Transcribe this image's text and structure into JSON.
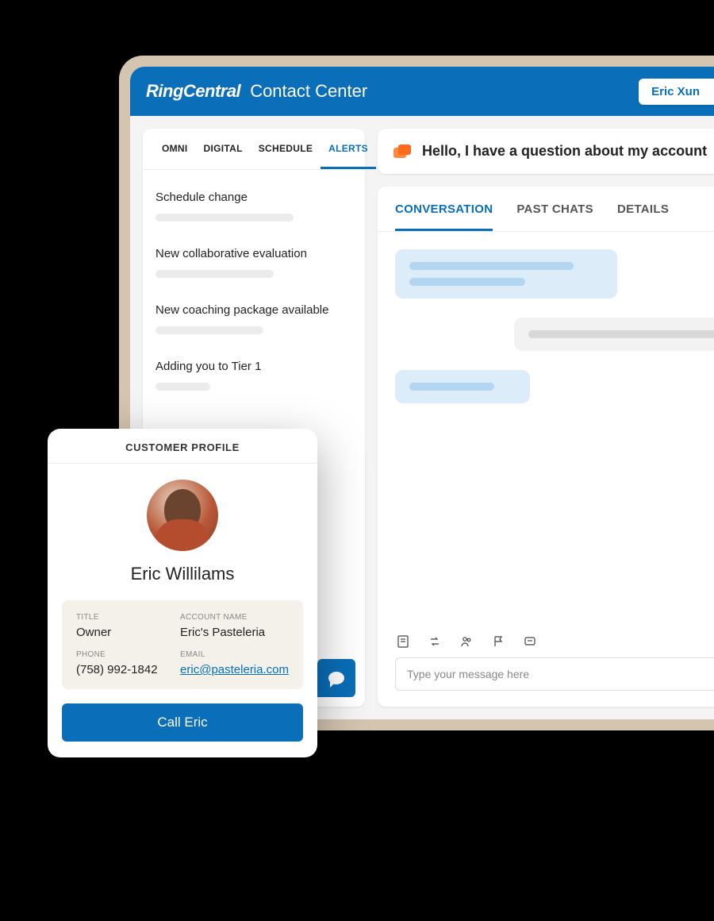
{
  "header": {
    "brand": "RingCentral",
    "product": "Contact Center",
    "user_name": "Eric Xun"
  },
  "sidebar": {
    "tabs": [
      "OMNI",
      "DIGITAL",
      "SCHEDULE",
      "ALERTS"
    ],
    "active_tab_index": 3,
    "alerts": [
      {
        "title": "Schedule change"
      },
      {
        "title": "New collaborative evaluation"
      },
      {
        "title": "New coaching package available"
      },
      {
        "title": "Adding you to Tier 1"
      }
    ]
  },
  "conversation": {
    "prompt": "Hello, I have a question about my account",
    "tabs": [
      "CONVERSATION",
      "PAST CHATS",
      "DETAILS"
    ],
    "active_tab_index": 0,
    "input_placeholder": "Type your message here",
    "toolbar_icons": [
      "notes-icon",
      "transfer-icon",
      "people-icon",
      "flag-icon",
      "quick-response-icon"
    ]
  },
  "profile": {
    "heading": "CUSTOMER PROFILE",
    "name": "Eric Willilams",
    "fields": {
      "title_label": "TITLE",
      "title_value": "Owner",
      "account_label": "ACCOUNT NAME",
      "account_value": "Eric's Pasteleria",
      "phone_label": "PHONE",
      "phone_value": "(758) 992-1842",
      "email_label": "EMAIL",
      "email_value": "eric@pasteleria.com"
    },
    "call_button": "Call Eric"
  }
}
